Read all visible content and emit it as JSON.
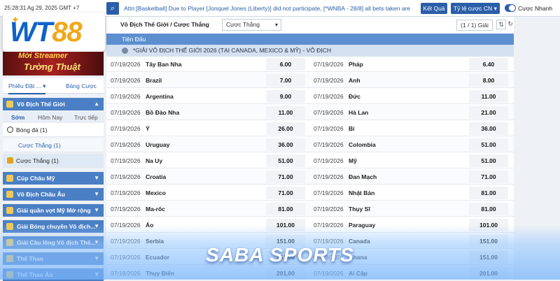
{
  "topbar": {
    "clock": "25:28:31 Ag 29, 2025 GMT +7",
    "ticker": "Attn:[Basketball] Due to Player [Jonquel Jones (Liberty)] did not participate, [*WNBA - 28/8] all bets taken are",
    "results_label": "Kết Quả",
    "odds_type": "Tỷ lệ cược CN",
    "quick_bet_label": "Cược Nhanh"
  },
  "logo": {
    "text_a": "WT",
    "text_b": "88"
  },
  "promo": {
    "line1": "Mời Streamer",
    "line2": "Tường Thuật"
  },
  "sidebar": {
    "tabs": [
      "Phiếu Đặt ...",
      "Bảng Cược"
    ],
    "active_section": "Vô Địch Thế Giới",
    "periods": [
      "Sớm",
      "Hôm Nay",
      "Trực tiếp"
    ],
    "sport_rows": [
      {
        "label": "Bóng đá",
        "count": "(1)"
      },
      {
        "label": "Cược Thắng",
        "count": "(1)"
      },
      {
        "label": "Cược Thắng",
        "count": "(1)"
      }
    ],
    "sections": [
      "Cúp Châu Mỹ",
      "Vô Địch Châu Âu",
      "Giải quần vợt Mỹ Mở rộng",
      "Giải Bóng chuyền Vô địch...",
      "Giải Cầu lông Vô địch Thế...",
      "Thể Thao",
      "Thể Thao Ảo"
    ]
  },
  "main": {
    "breadcrumb": "Vô Địch Thế Giới / Cược Thắng",
    "market": "Cược Thắng",
    "pager": "(1 / 1) Giải",
    "section_title": "Tiện Đấu",
    "league": "*GIẢI VÔ ĐỊCH THẾ GIỚI 2026 (TẠI CANADA, MEXICO & MỸ) - VÔ ĐỊCH",
    "rows": [
      {
        "d1": "07/19/2026",
        "t1": "Tây Ban Nha",
        "o1": "6.00",
        "d2": "07/19/2026",
        "t2": "Pháp",
        "o2": "6.40"
      },
      {
        "d1": "07/19/2026",
        "t1": "Brazil",
        "o1": "7.00",
        "d2": "07/19/2026",
        "t2": "Anh",
        "o2": "8.00"
      },
      {
        "d1": "07/19/2026",
        "t1": "Argentina",
        "o1": "9.00",
        "d2": "07/19/2026",
        "t2": "Đức",
        "o2": "11.00"
      },
      {
        "d1": "07/19/2026",
        "t1": "Bồ Đào Nha",
        "o1": "11.00",
        "d2": "07/19/2026",
        "t2": "Hà Lan",
        "o2": "21.00"
      },
      {
        "d1": "07/19/2026",
        "t1": "Ý",
        "o1": "26.00",
        "d2": "07/19/2026",
        "t2": "Bỉ",
        "o2": "36.00"
      },
      {
        "d1": "07/19/2026",
        "t1": "Uruguay",
        "o1": "36.00",
        "d2": "07/19/2026",
        "t2": "Colombia",
        "o2": "51.00"
      },
      {
        "d1": "07/19/2026",
        "t1": "Na Uy",
        "o1": "51.00",
        "d2": "07/19/2026",
        "t2": "Mỹ",
        "o2": "51.00"
      },
      {
        "d1": "07/19/2026",
        "t1": "Croatia",
        "o1": "71.00",
        "d2": "07/19/2026",
        "t2": "Đan Mạch",
        "o2": "71.00"
      },
      {
        "d1": "07/19/2026",
        "t1": "Mexico",
        "o1": "71.00",
        "d2": "07/19/2026",
        "t2": "Nhật Bản",
        "o2": "81.00"
      },
      {
        "d1": "07/19/2026",
        "t1": "Ma-rốc",
        "o1": "81.00",
        "d2": "07/19/2026",
        "t2": "Thụy Sĩ",
        "o2": "81.00"
      },
      {
        "d1": "07/19/2026",
        "t1": "Áo",
        "o1": "101.00",
        "d2": "07/19/2026",
        "t2": "Paraguay",
        "o2": "101.00"
      },
      {
        "d1": "07/19/2026",
        "t1": "Serbia",
        "o1": "151.00",
        "d2": "07/19/2026",
        "t2": "Canada",
        "o2": "151.00"
      },
      {
        "d1": "07/19/2026",
        "t1": "Ecuador",
        "o1": "151.00",
        "d2": "07/19/2026",
        "t2": "Ghana",
        "o2": "151.00"
      },
      {
        "d1": "07/19/2026",
        "t1": "Thụy Điển",
        "o1": "201.00",
        "d2": "07/19/2026",
        "t2": "Ai Cập",
        "o2": "201.00"
      }
    ]
  },
  "banner": {
    "text": "SABA SPORTS"
  },
  "colors": {
    "accent": "#2b5ea8",
    "header": "#5d8fd0",
    "league": "#d4e1f1",
    "logo_blue": "#0d63c8",
    "logo_gold": "#f0a81c"
  },
  "icons": {
    "search": "search-icon",
    "refresh": "refresh-icon",
    "sort": "sort-icon"
  }
}
